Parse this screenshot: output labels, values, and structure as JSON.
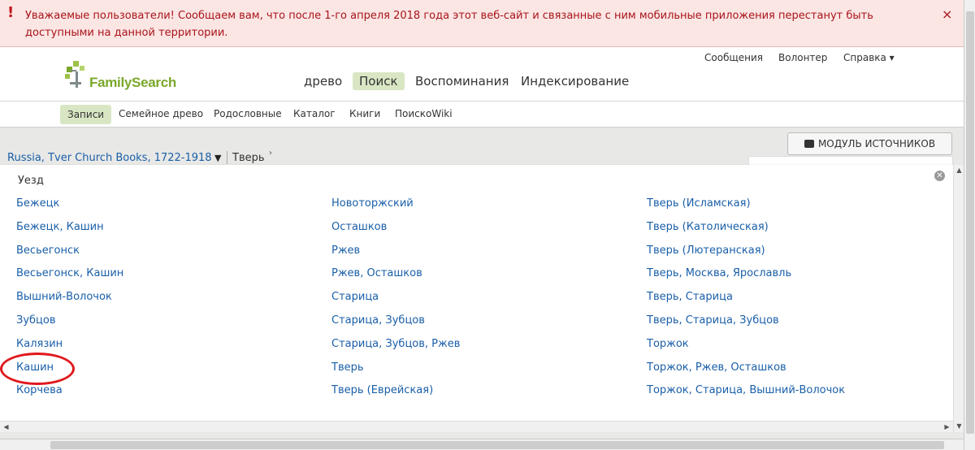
{
  "alert": {
    "icon": "!",
    "text": "Уважаемые пользователи! Сообщаем вам, что после 1-го апреля 2018 года этот веб-сайт и связанные с ним мобильные приложения перестанут быть доступными на данной территории.",
    "close": "×"
  },
  "header": {
    "logo": "FamilySearch",
    "util": {
      "messages": "Сообщения",
      "volunteer": "Волонтер",
      "help": "Справка ▾"
    },
    "nav": {
      "tree": "древо",
      "search": "Поиск",
      "memories": "Воспоминания",
      "indexing": "Индексирование"
    }
  },
  "subnav": {
    "records": "Записи",
    "family_tree": "Семейное древо",
    "genealogies": "Родословные",
    "catalog": "Каталог",
    "books": "Книги",
    "wiki": "ПоискоWiki"
  },
  "breadcrumb": {
    "collection": "Russia, Tver Church Books, 1722-1918",
    "current": "Тверь"
  },
  "source_box_button": "МОДУЛЬ ИСТОЧНИКОВ",
  "panel": {
    "title": "Уезд",
    "columns": [
      [
        "Бежецк",
        "Бежецк, Кашин",
        "Весьегонск",
        "Весьегонск, Кашин",
        "Вышний-Волочок",
        "Зубцов",
        "Калязин",
        "Кашин",
        "Корчева"
      ],
      [
        "Новоторжский",
        "Осташков",
        "Ржев",
        "Ржев, Осташков",
        "Старица",
        "Старица, Зубцов",
        "Старица, Зубцов, Ржев",
        "Тверь",
        "Тверь (Еврейская)"
      ],
      [
        "Тверь (Исламская)",
        "Тверь (Католическая)",
        "Тверь (Лютеранская)",
        "Тверь, Москва, Ярославль",
        "Тверь, Старица",
        "Тверь, Старица, Зубцов",
        "Торжок",
        "Торжок, Ржев, Осташков",
        "Торжок, Старица, Вышний-Волочок"
      ]
    ]
  },
  "colors": {
    "link": "#1a5fa8",
    "brand_green": "#7aa82b",
    "alert_text": "#a8141a",
    "highlight_circle": "#e0191e"
  }
}
